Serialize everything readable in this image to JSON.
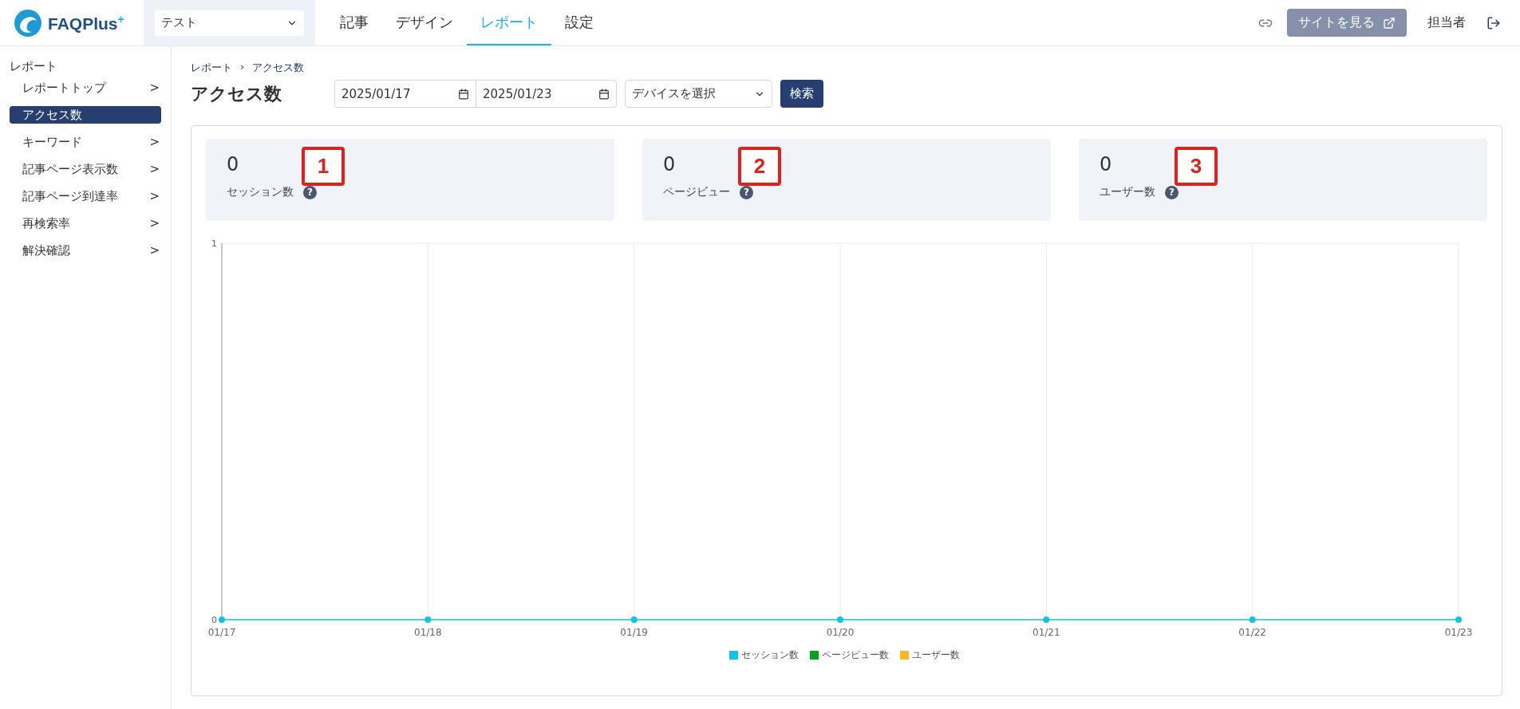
{
  "header": {
    "logo": {
      "name": "FAQPlus",
      "sup": "+"
    },
    "site_select": {
      "value": "テスト"
    },
    "nav": [
      {
        "label": "記事",
        "selected": false
      },
      {
        "label": "デザイン",
        "selected": false
      },
      {
        "label": "レポート",
        "selected": true
      },
      {
        "label": "設定",
        "selected": false
      }
    ],
    "view_site_button": "サイトを見る",
    "user": "担当者"
  },
  "sidebar": {
    "section": "レポート",
    "items": [
      {
        "label": "レポートトップ",
        "arrow": ">",
        "selected": false
      },
      {
        "label": "アクセス数",
        "selected": true
      },
      {
        "label": "キーワード",
        "arrow": ">",
        "selected": false
      },
      {
        "label": "記事ページ表示数",
        "arrow": ">",
        "selected": false
      },
      {
        "label": "記事ページ到達率",
        "arrow": ">",
        "selected": false
      },
      {
        "label": "再検索率",
        "arrow": ">",
        "selected": false
      },
      {
        "label": "解決確認",
        "arrow": ">",
        "selected": false
      }
    ]
  },
  "breadcrumb": [
    "レポート",
    "›",
    "アクセス数"
  ],
  "page_title": "アクセス数",
  "filters": {
    "start_date": "2025/01/17",
    "end_date": "2025/01/23",
    "device_placeholder": "デバイスを選択",
    "search_button": "検索"
  },
  "cards": [
    {
      "value": "0",
      "label": "セッション数",
      "help_icon": "?",
      "marker": "1"
    },
    {
      "value": "0",
      "label": "ページビュー",
      "help_icon": "?",
      "marker": "2"
    },
    {
      "value": "0",
      "label": "ユーザー数",
      "help_icon": "?",
      "marker": "3"
    }
  ],
  "chart_data": {
    "type": "line",
    "categories": [
      "01/17",
      "01/18",
      "01/19",
      "01/20",
      "01/21",
      "01/22",
      "01/23"
    ],
    "series": [
      {
        "name": "セッション数",
        "color": "#0dc4ea",
        "marker": true,
        "values": [
          0,
          0,
          0,
          0,
          0,
          0,
          0
        ]
      },
      {
        "name": "ページビュー数",
        "color": "#00a61a",
        "values": [
          null,
          null,
          null,
          null,
          null,
          null,
          null
        ]
      },
      {
        "name": "ユーザー数",
        "color": "#ffb81c",
        "values": [
          null,
          null,
          null,
          null,
          null,
          null,
          null
        ]
      }
    ],
    "ylim": [
      0,
      1
    ],
    "yticks": [
      0,
      1
    ],
    "grid": true,
    "legend": "bottom"
  }
}
